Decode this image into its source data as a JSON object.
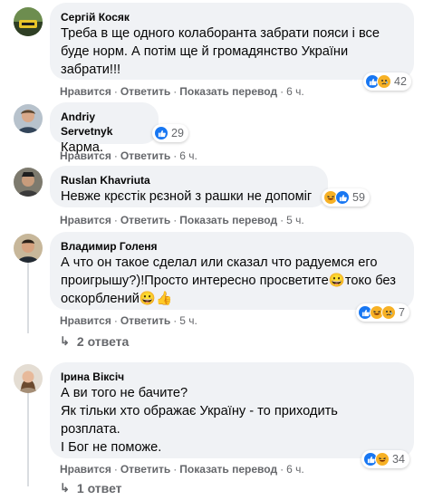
{
  "actions": {
    "like": "Нравится",
    "reply": "Ответить",
    "translate": "Показать перевод",
    "sep": "·"
  },
  "comments": [
    {
      "author": "Сергій Косяк",
      "text": "Треба в ще одного колаборанта забрати пояси і все\nбуде норм. А потім ще й громадянство України\nзабрати!!!",
      "reactions": [
        "like",
        "sad"
      ],
      "reaction_count": "42",
      "time": "6 ч.",
      "show_translate": true
    },
    {
      "author": "Andriy Servetnyk",
      "text": "Карма.",
      "reactions": [
        "like"
      ],
      "reaction_count": "29",
      "time": "6 ч.",
      "show_translate": false
    },
    {
      "author": "Ruslan Khavriuta",
      "text": "Невже крєстік рєзной з рашки не допоміг",
      "reactions": [
        "haha",
        "like"
      ],
      "reaction_count": "59",
      "time": "5 ч.",
      "show_translate": true
    },
    {
      "author": "Владимир Голеня",
      "text": "А что он такое сделал или сказал что радуемся его\nпроигрышу?)!Просто интересно просветите😀токо без\nоскорблений😀👍",
      "reactions": [
        "like",
        "haha",
        "sad"
      ],
      "reaction_count": "7",
      "time": "5 ч.",
      "show_translate": false,
      "replies_label": "2 ответа"
    },
    {
      "author": "Ірина Віксіч",
      "text": "А ви того не бачите?\nЯк тільки хто ображає Україну - то приходить\nрозплата.\nІ Бог не поможе.",
      "reactions": [
        "like",
        "haha"
      ],
      "reaction_count": "34",
      "time": "6 ч.",
      "show_translate": true,
      "replies_label": "1 ответ"
    }
  ],
  "colors": {
    "bubble": "#f0f2f5",
    "secondary_text": "#65676b",
    "like_blue": "#1877f2",
    "emoji_yellow": "#f7b125"
  },
  "icons": {
    "like": "thumbs-up-icon",
    "haha": "laughing-face-icon",
    "sad": "sad-face-icon",
    "reply_arrow": "reply-arrow-icon"
  }
}
